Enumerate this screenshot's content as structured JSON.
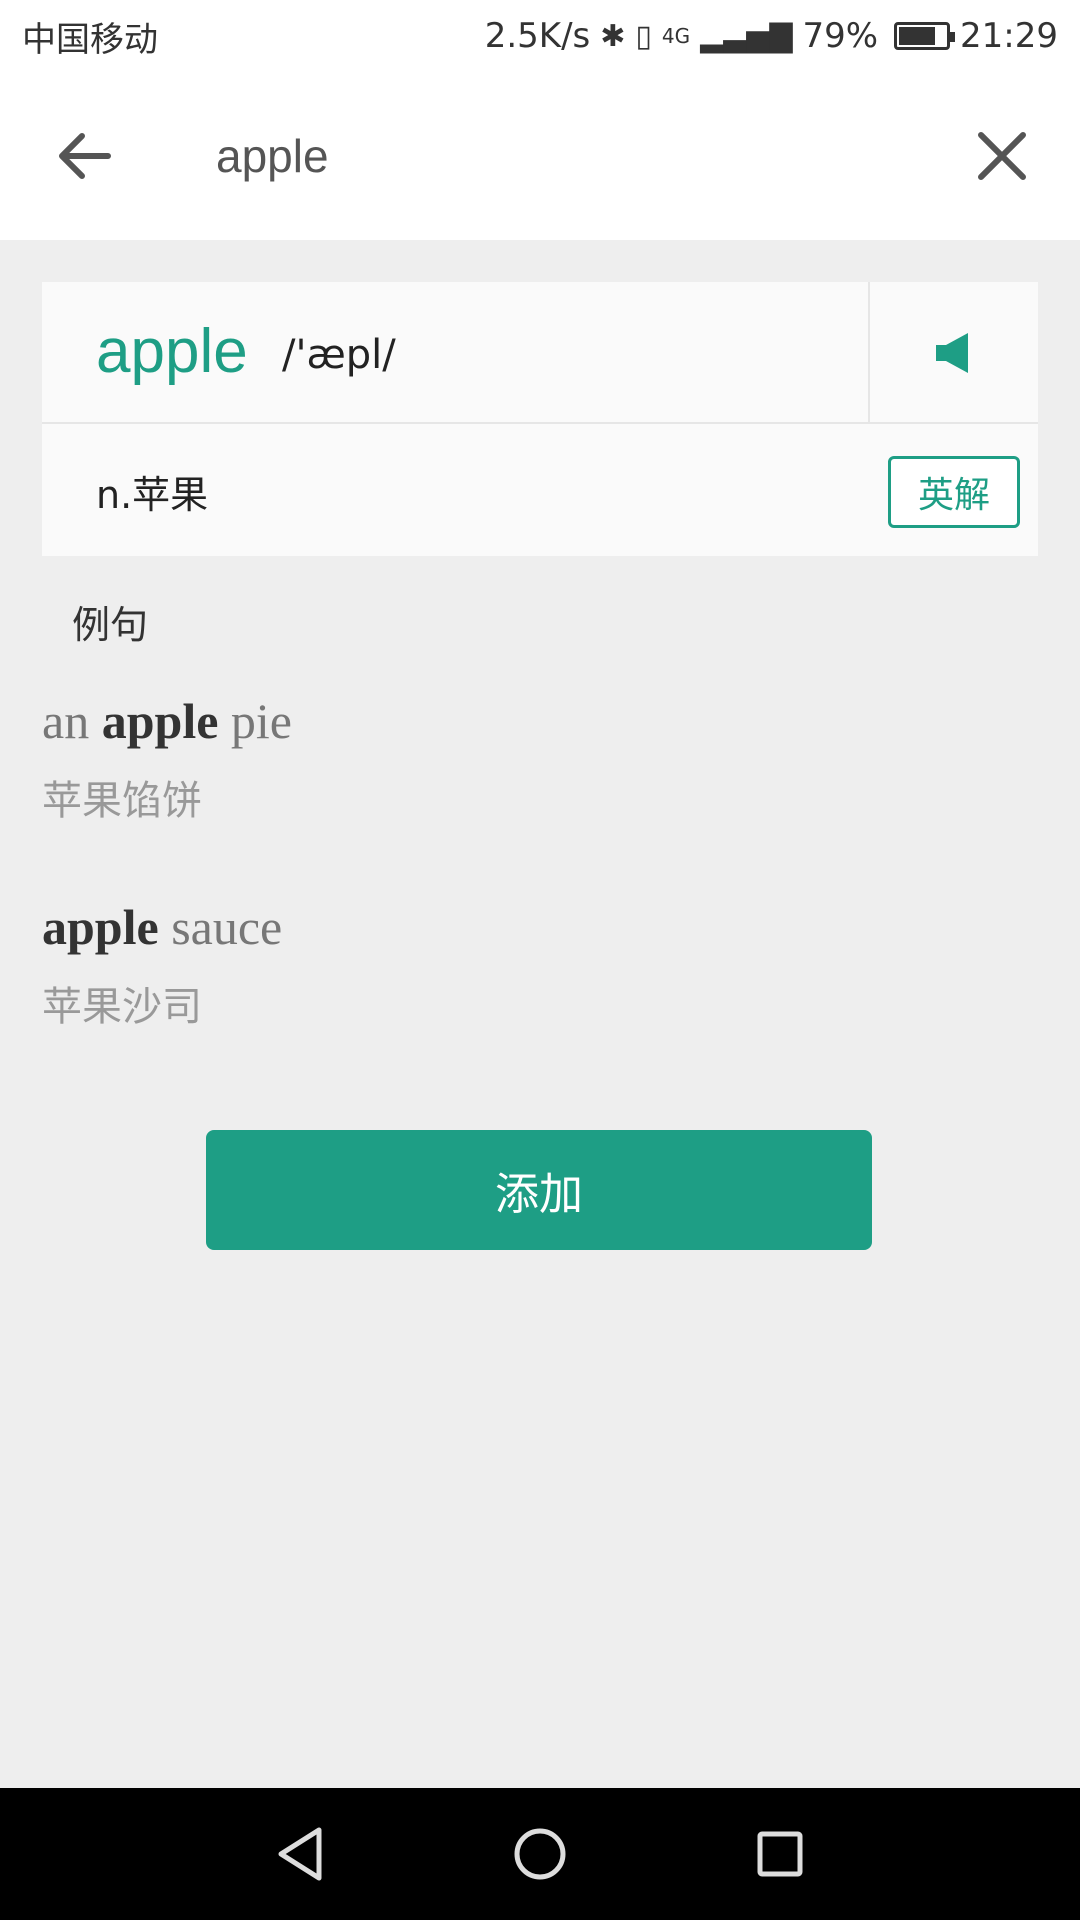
{
  "status_bar": {
    "carrier": "中国移动",
    "speed": "2.5K/s",
    "network": "4G",
    "battery_percent": "79%",
    "battery_level": 0.79,
    "time": "21:29"
  },
  "search": {
    "query": "apple"
  },
  "word": {
    "headword": "apple",
    "phonetic": "/'æpl/",
    "meaning": "n.苹果",
    "en_explain_label": "英解"
  },
  "examples": {
    "heading": "例句",
    "items": [
      {
        "pre": "an ",
        "bold": "apple",
        "post": " pie",
        "translation": "苹果馅饼"
      },
      {
        "pre": "",
        "bold": "apple",
        "post": " sauce",
        "translation": "苹果沙司"
      }
    ]
  },
  "actions": {
    "add_label": "添加"
  },
  "colors": {
    "accent": "#1e9e85",
    "background": "#eeeeee"
  },
  "icons": {
    "back": "arrow-left-icon",
    "close": "close-icon",
    "speaker": "speaker-icon",
    "nav_back": "triangle-back-icon",
    "nav_home": "circle-home-icon",
    "nav_recents": "square-recents-icon"
  }
}
